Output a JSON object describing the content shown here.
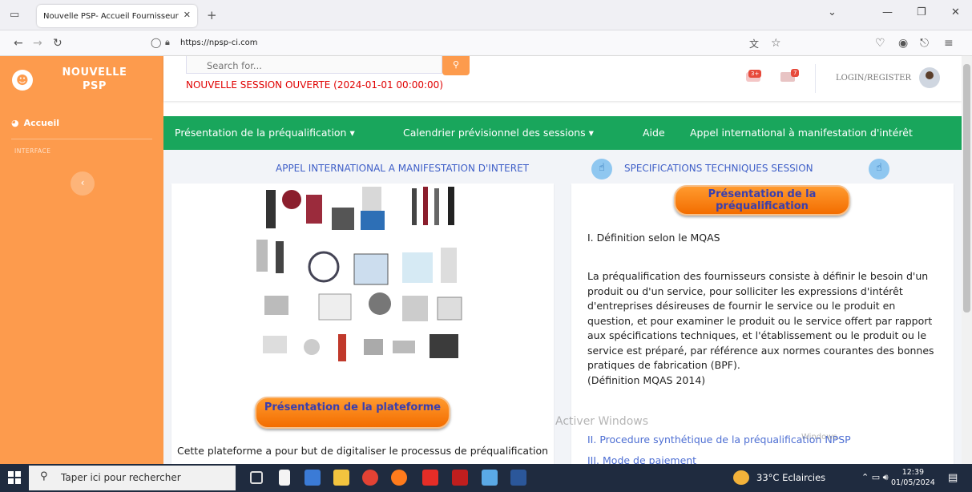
{
  "browser": {
    "tab_title": "Nouvelle PSP- Accueil Fournisseur",
    "url": "https://npsp-ci.com"
  },
  "sidebar": {
    "brand": "NOUVELLE PSP",
    "items": [
      {
        "label": "Accueil",
        "icon": "dashboard-icon"
      }
    ],
    "heading": "INTERFACE"
  },
  "topbar": {
    "search_placeholder": "Search for...",
    "session_message": "NOUVELLE SESSION OUVERTE (2024-01-01 00:00:00)",
    "alerts_badge": "3+",
    "messages_badge": "7",
    "login_label": "LOGIN/REGISTER"
  },
  "menu": {
    "items": [
      "Présentation de la préqualification ▾",
      "Calendrier prévisionnel des sessions ▾",
      "Aide",
      "Appel international à manifestation d'intérêt"
    ]
  },
  "links": {
    "appel": "APPEL INTERNATIONAL A MANIFESTATION D'INTERET",
    "specs": "SPECIFICATIONS TECHNIQUES SESSION"
  },
  "left_card": {
    "button": "Présentation de la plateforme",
    "text": "Cette plateforme a pour but de digitaliser le processus de préqualification"
  },
  "right_card": {
    "button": "Présentation de la préqualification",
    "def_title": "I. Définition selon le MQAS",
    "def_body": "La préqualification des fournisseurs consiste à définir le besoin d'un produit ou d'un service, pour solliciter les expressions d'intérêt d'entreprises désireuses de fournir le service ou le produit en question, et pour examiner le produit ou le service offert par rapport aux spécifications techniques, et l'établissement ou le produit ou le service est préparé, par référence aux normes courantes des bonnes pratiques de fabrication (BPF).",
    "def_source": "(Définition MQAS 2014)",
    "procedure": "II. Procedure synthétique de la préqualification NPSP",
    "modes": "III. Mode de paiement"
  },
  "watermark": {
    "line1": "Activer Windows",
    "line2": "Windows."
  },
  "taskbar": {
    "search_placeholder": "Taper ici pour rechercher",
    "weather": "33°C  Eclaircies",
    "time": "12:39",
    "date": "01/05/2024"
  },
  "colors": {
    "accent": "#fd9b4d",
    "menu": "#19a65c",
    "alert": "#e00000"
  }
}
